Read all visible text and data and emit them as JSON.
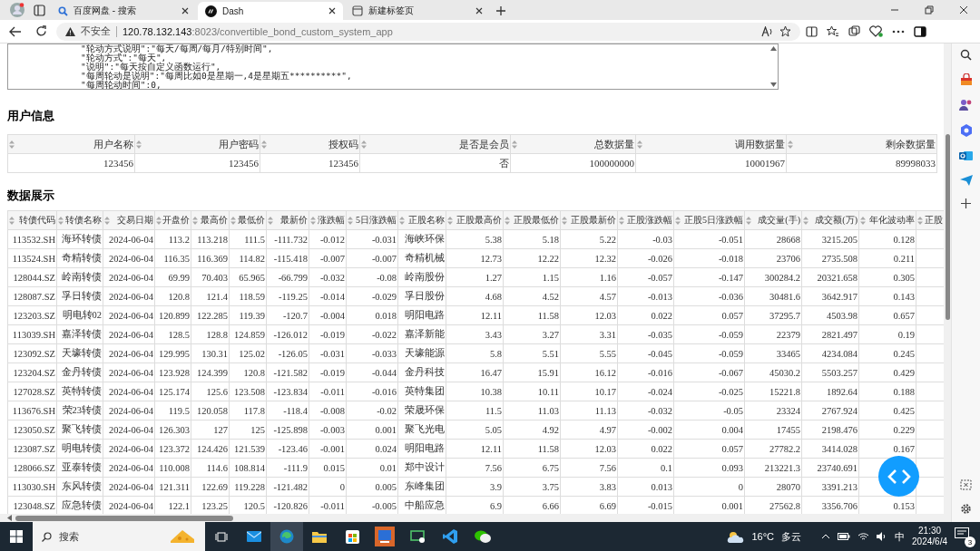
{
  "browser": {
    "tabs": [
      {
        "title": "百度网盘 - 搜索",
        "selected": false
      },
      {
        "title": "Dash",
        "selected": true
      },
      {
        "title": "新建标签页",
        "selected": false
      }
    ],
    "security": "不安全",
    "url_host": "120.78.132.143",
    "url_rest": ":8023/convertible_bond_custom_system_app"
  },
  "config_text": [
    "\"轮动方式说明\":\"每天/每周/每月/特别时间\",",
    "\"轮动方式\":\"每天\",",
    "\"说明\":\"每天按自定义函数运行\",",
    "\"每周轮动是说明\":\"每周比如0是星期一,4是星期五**********\",",
    "\"每周轮动时间\":0,"
  ],
  "user_info": {
    "heading": "用户信息",
    "columns": [
      "用户名称",
      "用户密码",
      "授权码",
      "是否是会员",
      "总数据量",
      "调用数据量",
      "剩余数据量"
    ],
    "row": [
      "123456",
      "123456",
      "123456",
      "否",
      "100000000",
      "10001967",
      "89998033"
    ]
  },
  "data_display": {
    "heading": "数据展示",
    "columns": [
      "转债代码",
      "转债名称",
      "交易日期",
      "开盘价",
      "最高价",
      "最低价",
      "最新价",
      "涨跌幅",
      "5日涨跌幅",
      "正股名称",
      "正股最高价",
      "正股最低价",
      "正股最新价",
      "正股涨跌幅",
      "正股5日涨跌幅",
      "成交量(手)",
      "成交额(万)",
      "年化波动率",
      "正股"
    ],
    "rows": [
      [
        "113532.SH",
        "海环转债",
        "2024-06-04",
        "113.2",
        "113.218",
        "111.5",
        "-111.732",
        "-0.012",
        "-0.031",
        "海峡环保",
        "5.38",
        "5.18",
        "5.22",
        "-0.03",
        "-0.051",
        "28668",
        "3215.205",
        "0.128"
      ],
      [
        "113524.SH",
        "奇精转债",
        "2024-06-04",
        "116.35",
        "116.369",
        "114.82",
        "-115.418",
        "-0.007",
        "-0.007",
        "奇精机械",
        "12.73",
        "12.22",
        "12.32",
        "-0.026",
        "-0.018",
        "23706",
        "2735.508",
        "0.211"
      ],
      [
        "128044.SZ",
        "岭南转债",
        "2024-06-04",
        "69.99",
        "70.403",
        "65.965",
        "-66.799",
        "-0.032",
        "-0.08",
        "岭南股份",
        "1.27",
        "1.15",
        "1.16",
        "-0.057",
        "-0.147",
        "300284.2",
        "20321.658",
        "0.305"
      ],
      [
        "128087.SZ",
        "孚日转债",
        "2024-06-04",
        "120.8",
        "121.4",
        "118.59",
        "-119.25",
        "-0.014",
        "-0.029",
        "孚日股份",
        "4.68",
        "4.52",
        "4.57",
        "-0.013",
        "-0.036",
        "30481.6",
        "3642.917",
        "0.143"
      ],
      [
        "123203.SZ",
        "明电转02",
        "2024-06-04",
        "120.899",
        "122.285",
        "119.39",
        "-120.7",
        "-0.004",
        "0.018",
        "明阳电路",
        "12.11",
        "11.58",
        "12.03",
        "0.022",
        "0.057",
        "37295.7",
        "4503.98",
        "0.657"
      ],
      [
        "113039.SH",
        "嘉泽转债",
        "2024-06-04",
        "128.5",
        "128.8",
        "124.859",
        "-126.012",
        "-0.019",
        "-0.022",
        "嘉泽新能",
        "3.43",
        "3.27",
        "3.31",
        "-0.035",
        "-0.059",
        "22379",
        "2821.497",
        "0.19"
      ],
      [
        "123092.SZ",
        "天壕转债",
        "2024-06-04",
        "129.995",
        "130.31",
        "125.02",
        "-126.05",
        "-0.031",
        "-0.033",
        "天壕能源",
        "5.8",
        "5.51",
        "5.55",
        "-0.045",
        "-0.059",
        "33465",
        "4234.084",
        "0.245"
      ],
      [
        "123204.SZ",
        "金丹转债",
        "2024-06-04",
        "123.928",
        "124.399",
        "120.8",
        "-121.582",
        "-0.019",
        "-0.044",
        "金丹科技",
        "16.47",
        "15.91",
        "16.12",
        "-0.016",
        "-0.067",
        "45030.2",
        "5503.257",
        "0.429"
      ],
      [
        "127028.SZ",
        "英特转债",
        "2024-06-04",
        "125.174",
        "125.6",
        "123.508",
        "-123.834",
        "-0.011",
        "-0.016",
        "英特集团",
        "10.38",
        "10.11",
        "10.17",
        "-0.024",
        "-0.025",
        "15221.8",
        "1892.64",
        "0.188"
      ],
      [
        "113676.SH",
        "荣23转债",
        "2024-06-04",
        "119.5",
        "120.058",
        "117.8",
        "-118.4",
        "-0.008",
        "-0.02",
        "荣晟环保",
        "11.5",
        "11.03",
        "11.13",
        "-0.032",
        "-0.05",
        "23324",
        "2767.924",
        "0.425"
      ],
      [
        "123050.SZ",
        "聚飞转债",
        "2024-06-04",
        "126.303",
        "127",
        "125",
        "-125.898",
        "-0.003",
        "0.001",
        "聚飞光电",
        "5.05",
        "4.92",
        "4.97",
        "-0.002",
        "0.004",
        "17455",
        "2198.476",
        "0.229"
      ],
      [
        "123087.SZ",
        "明电转债",
        "2024-06-04",
        "123.372",
        "124.426",
        "121.539",
        "-123.46",
        "-0.001",
        "0.024",
        "明阳电路",
        "12.11",
        "11.58",
        "12.03",
        "0.022",
        "0.057",
        "27782.2",
        "3414.028",
        "0.167"
      ],
      [
        "128066.SZ",
        "亚泰转债",
        "2024-06-04",
        "110.008",
        "114.6",
        "108.814",
        "-111.9",
        "0.015",
        "0.01",
        "郑中设计",
        "7.56",
        "6.75",
        "7.56",
        "0.1",
        "0.093",
        "213221.3",
        "23740.691",
        null
      ],
      [
        "113030.SH",
        "东风转债",
        "2024-06-04",
        "121.311",
        "122.69",
        "119.228",
        "-121.482",
        "0",
        "0.005",
        "东峰集团",
        "3.9",
        "3.75",
        "3.83",
        "0.013",
        "0",
        "28070",
        "3391.213",
        null
      ],
      [
        "123048.SZ",
        "应急转债",
        "2024-06-04",
        "122.1",
        "123.25",
        "120.5",
        "-120.826",
        "-0.011",
        "-0.005",
        "中船应急",
        "6.9",
        "6.66",
        "6.69",
        "-0.015",
        "0.001",
        "27562.8",
        "3356.706",
        "0.153"
      ]
    ]
  },
  "taskbar": {
    "search_placeholder": "搜索",
    "temperature": "16°C",
    "weather": "多云",
    "ime": "中",
    "time": "21:30",
    "date": "2024/6/4",
    "notifications": "3"
  }
}
